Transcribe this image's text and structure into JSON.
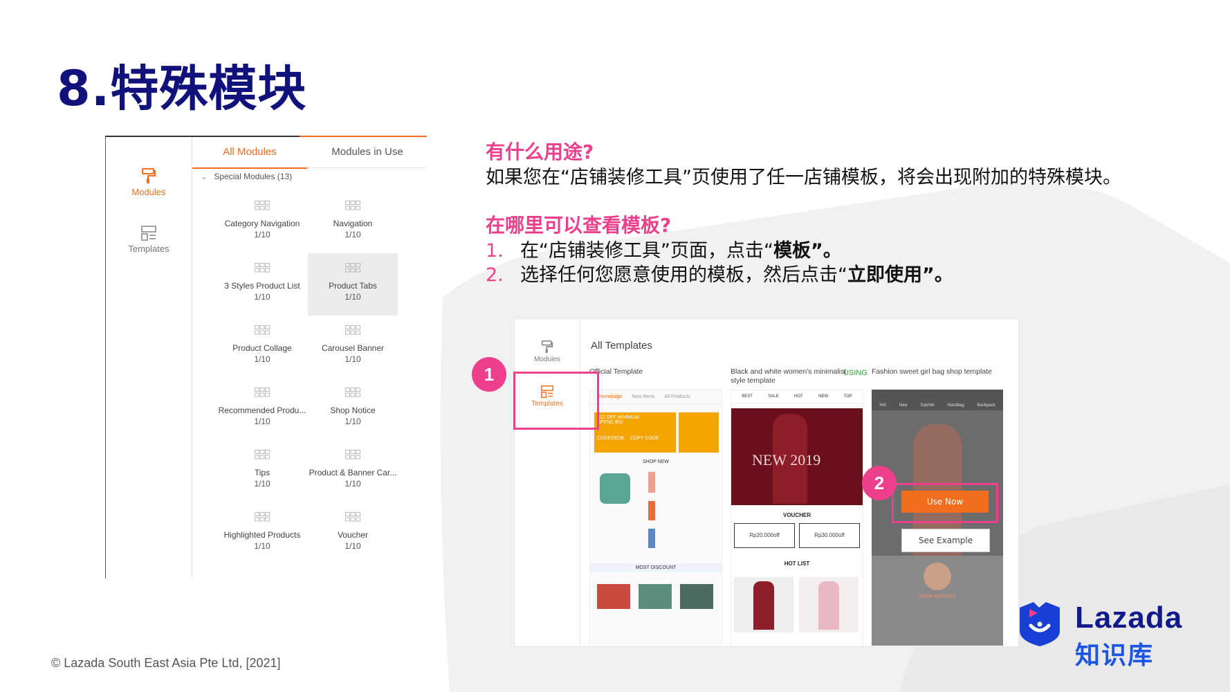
{
  "slide": {
    "title": "8.特殊模块",
    "footer": "© Lazada South East Asia Pte Ltd, [2021]"
  },
  "left_panel": {
    "sidebar": [
      {
        "label": "Modules",
        "icon": "paint-roller-icon",
        "active": true
      },
      {
        "label": "Templates",
        "icon": "template-layout-icon",
        "active": false
      }
    ],
    "tabs": [
      {
        "label": "All Modules",
        "active": true
      },
      {
        "label": "Modules in Use",
        "active": false
      }
    ],
    "group_label": "Special Modules (13)",
    "modules": [
      {
        "name": "Category Navigation",
        "count": "1/10"
      },
      {
        "name": "Navigation",
        "count": "1/10"
      },
      {
        "name": "3 Styles Product List",
        "count": "1/10"
      },
      {
        "name": "Product Tabs",
        "count": "1/10"
      },
      {
        "name": "Product Collage",
        "count": "1/10"
      },
      {
        "name": "Carousel Banner",
        "count": "1/10"
      },
      {
        "name": "Recommended Produ...",
        "count": "1/10"
      },
      {
        "name": "Shop Notice",
        "count": "1/10"
      },
      {
        "name": "Tips",
        "count": "1/10"
      },
      {
        "name": "Product & Banner Car...",
        "count": "1/10"
      },
      {
        "name": "Highlighted Products",
        "count": "1/10"
      },
      {
        "name": "Voucher",
        "count": "1/10"
      }
    ]
  },
  "explanation": {
    "q1": "有什么用途?",
    "a1": "如果您在“店铺装修工具”页使用了任一店铺模板，将会出现附加的特殊模块。",
    "q2": "在哪里可以查看模板?",
    "steps": [
      {
        "num": "1.",
        "text": "在“店铺装修工具”页面，点击“",
        "bold": "模板”。"
      },
      {
        "num": "2.",
        "text": "选择任何您愿意使用的模板，然后点击“",
        "bold": "立即使用”。"
      }
    ]
  },
  "templates_screen": {
    "sidebar": [
      {
        "label": "Modules",
        "icon": "paint-roller-icon"
      },
      {
        "label": "Templates",
        "icon": "template-layout-icon"
      }
    ],
    "title": "All Templates",
    "using_label": "USING",
    "cards": [
      {
        "caption": "Official Template",
        "tabs": [
          "Homepage",
          "New Items",
          "All Products"
        ],
        "coupon_lines": [
          "$12 OFF MINIMUM",
          "SPEND $50"
        ],
        "coupon_codes": [
          "CODEDEDE",
          "COPY CODE"
        ],
        "section_labels": [
          "SHOP NEW",
          "MOST DISCOUNT"
        ]
      },
      {
        "caption": "Black and white women's minimalist style template",
        "tabs": [
          "BEST",
          "SALE",
          "HOT",
          "NEW",
          "TOP"
        ],
        "banner_text": "NEW 2019",
        "section_labels": [
          "VOUCHER",
          "HOT LIST"
        ],
        "vouchers": [
          "Rp20.000off",
          "Rp30.000off"
        ]
      },
      {
        "caption": "Fashion sweet girl bag shop template",
        "tabs": [
          "Hot",
          "New",
          "Satchel",
          "Handbag",
          "Backpack"
        ],
        "section_labels": [
          "SHOP NOTICES"
        ]
      }
    ],
    "use_now": "Use Now",
    "see_example": "See Example",
    "badges": [
      "1",
      "2"
    ]
  },
  "logo": {
    "wordmark": "Lazada",
    "subtitle": "知识库",
    "colors": {
      "navy": "#101a8a",
      "blue": "#1a55e8",
      "pink": "#ec3f8c"
    }
  },
  "colors": {
    "title": "#10117a",
    "accent_pink": "#ec3f8c",
    "accent_orange": "#f36d1e"
  }
}
